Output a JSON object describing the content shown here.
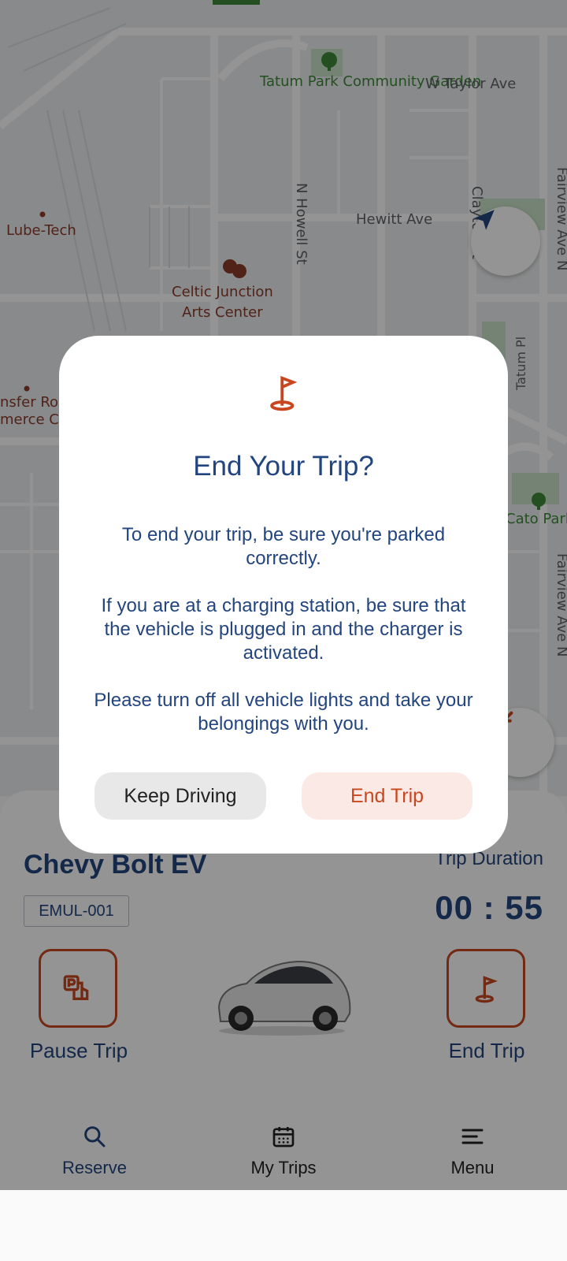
{
  "map": {
    "labels": {
      "park": "Tatum Park\nCommunity Garden",
      "w_taylor": "W Taylor Ave",
      "lube_tech": "Lube-Tech",
      "hewitt": "Hewitt Ave",
      "n_howell": "N Howell St",
      "clayton": "Clayton St",
      "fairview_top": "Fairview Ave N",
      "celtic": "Celtic Junction\nArts Center",
      "transfer": "nsfer Ro\nmerce Ce",
      "tatum_pl": "Tatum Pl",
      "cato_park": "Cato Park",
      "fairview_bottom": "Fairview Ave N"
    }
  },
  "panel": {
    "car_name": "Chevy Bolt EV",
    "plate": "EMUL-001",
    "duration_label": "Trip Duration",
    "duration_value": "00 : 55",
    "pause_label": "Pause Trip",
    "end_label": "End Trip"
  },
  "nav": {
    "reserve": "Reserve",
    "trips": "My Trips",
    "menu": "Menu"
  },
  "dialog": {
    "title": "End Your Trip?",
    "para1": "To end your trip, be sure you're parked correctly.",
    "para2": "If you are at a charging station, be sure that the vehicle is plugged in and the charger is activated.",
    "para3": "Please turn off all vehicle lights and take your belongings with you.",
    "keep_label": "Keep Driving",
    "end_label": "End Trip"
  },
  "colors": {
    "accent": "#c8471f",
    "navy": "#23457f"
  }
}
